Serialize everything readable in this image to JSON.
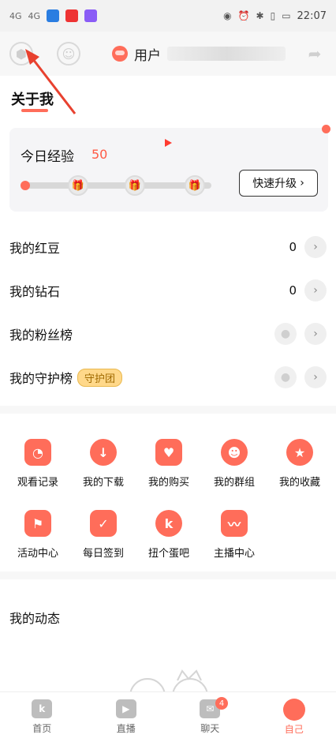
{
  "status_bar": {
    "network_1": "4G",
    "network_2": "4G",
    "time": "22:07",
    "icons": [
      "eye-icon",
      "alarm-icon",
      "bluetooth-icon",
      "vibrate-icon",
      "battery-icon"
    ]
  },
  "top_bar": {
    "username_prefix": "用户",
    "left_icon": "hexagon-settings-icon",
    "mid_icon": "face-icon",
    "right_icon": "share-icon"
  },
  "about": {
    "title": "关于我"
  },
  "experience": {
    "label": "今日经验",
    "value": "50",
    "progress_fraction": 0.0,
    "upgrade_label": "快速升级",
    "upgrade_chevron": "›"
  },
  "rows": [
    {
      "label": "我的红豆",
      "value": "0"
    },
    {
      "label": "我的钻石",
      "value": "0"
    },
    {
      "label": "我的粉丝榜",
      "value": ""
    },
    {
      "label": "我的守护榜",
      "value": "",
      "badge": "守护团"
    }
  ],
  "grid": [
    {
      "label": "观看记录",
      "icon": "clock-icon"
    },
    {
      "label": "我的下载",
      "icon": "download-icon"
    },
    {
      "label": "我的购买",
      "icon": "bag-heart-icon"
    },
    {
      "label": "我的群组",
      "icon": "group-icon"
    },
    {
      "label": "我的收藏",
      "icon": "star-icon"
    },
    {
      "label": "活动中心",
      "icon": "flag-icon"
    },
    {
      "label": "每日签到",
      "icon": "calendar-check-icon"
    },
    {
      "label": "扭个蛋吧",
      "icon": "k-coin-icon"
    },
    {
      "label": "主播中心",
      "icon": "chart-icon"
    }
  ],
  "feed": {
    "title": "我的动态"
  },
  "tabbar": {
    "home": "首页",
    "live": "直播",
    "chat": "聊天",
    "chat_badge": "4",
    "me": "自己"
  },
  "colors": {
    "accent": "#ff6d5a",
    "progress_bg": "#d8d8d8",
    "card_bg": "#f5f5f7"
  }
}
